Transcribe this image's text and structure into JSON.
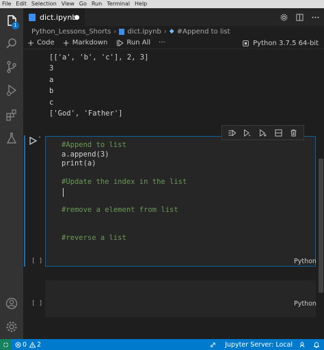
{
  "menu": [
    "File",
    "Edit",
    "Selection",
    "View",
    "Go",
    "Run",
    "Terminal",
    "Help"
  ],
  "activity": {
    "explorer_badge": "1"
  },
  "tab": {
    "label": "dict.ipynb"
  },
  "breadcrumb": {
    "folder": "Python_Lessons_Shorts",
    "file": "dict.ipynb",
    "symbol": "#Append to list"
  },
  "toolbar": {
    "code_label": "Code",
    "markdown_label": "Markdown",
    "run_all_label": "Run All",
    "more_label": "···",
    "kernel_label": "Python 3.7.5 64-bit"
  },
  "output": [
    "[['a', 'b', 'c'], 2, 3]",
    "3",
    "a",
    "b",
    "c",
    "['God', 'Father']"
  ],
  "cell1": {
    "lines": [
      "#Append to list",
      "a.append(3)",
      "print(a)",
      "",
      "#Update the index in the list",
      "",
      "",
      "#remove a element from list",
      "",
      "",
      "#reverse a list"
    ],
    "exec_count": "[ ]",
    "language": "Python"
  },
  "cell2": {
    "exec_count": "[ ]",
    "language": "Python"
  },
  "statusbar": {
    "errors": "0",
    "warnings": "2",
    "jupyter": "Jupyter Server: Local"
  },
  "colors": {
    "accent": "#007acc",
    "comment": "#6a9955",
    "focus_border": "#0e639c"
  }
}
